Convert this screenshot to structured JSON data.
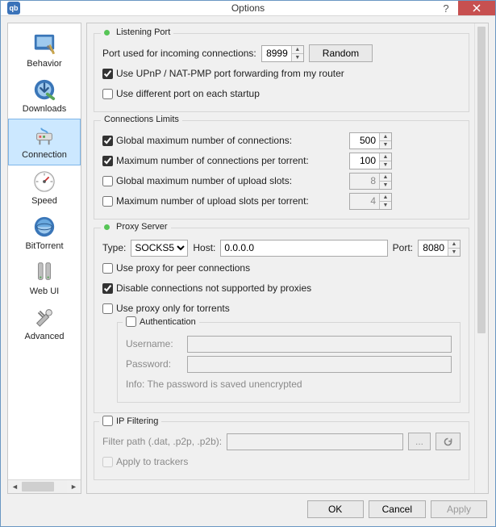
{
  "window": {
    "title": "Options"
  },
  "sidebar": {
    "items": [
      {
        "label": "Behavior"
      },
      {
        "label": "Downloads"
      },
      {
        "label": "Connection"
      },
      {
        "label": "Speed"
      },
      {
        "label": "BitTorrent"
      },
      {
        "label": "Web UI"
      },
      {
        "label": "Advanced"
      }
    ],
    "selected_index": 2
  },
  "listening_port": {
    "legend": "Listening Port",
    "port_label": "Port used for incoming connections:",
    "port_value": "8999",
    "random_btn": "Random",
    "upnp_checked": true,
    "upnp_label": "Use UPnP / NAT-PMP port forwarding from my router",
    "diffstart_checked": false,
    "diffstart_label": "Use different port on each startup"
  },
  "conn_limits": {
    "legend": "Connections Limits",
    "rows": [
      {
        "checked": true,
        "label": "Global maximum number of connections:",
        "value": "500",
        "enabled": true
      },
      {
        "checked": true,
        "label": "Maximum number of connections per torrent:",
        "value": "100",
        "enabled": true
      },
      {
        "checked": false,
        "label": "Global maximum number of upload slots:",
        "value": "8",
        "enabled": false
      },
      {
        "checked": false,
        "label": "Maximum number of upload slots per torrent:",
        "value": "4",
        "enabled": false
      }
    ]
  },
  "proxy": {
    "legend": "Proxy Server",
    "type_label": "Type:",
    "type_value": "SOCKS5",
    "host_label": "Host:",
    "host_value": "0.0.0.0",
    "port_label": "Port:",
    "port_value": "8080",
    "use_peer_checked": false,
    "use_peer_label": "Use proxy for peer connections",
    "disable_unsupported_checked": true,
    "disable_unsupported_label": "Disable connections not supported by proxies",
    "only_torrents_checked": false,
    "only_torrents_label": "Use proxy only for torrents",
    "auth": {
      "checked": false,
      "legend": "Authentication",
      "username_label": "Username:",
      "username_value": "",
      "password_label": "Password:",
      "password_value": "",
      "info": "Info: The password is saved unencrypted"
    }
  },
  "ipfilter": {
    "checked": false,
    "legend": "IP Filtering",
    "path_label": "Filter path (.dat, .p2p, .p2b):",
    "path_value": "",
    "browse_btn": "...",
    "apply_trackers_checked": false,
    "apply_trackers_label": "Apply to trackers"
  },
  "buttons": {
    "ok": "OK",
    "cancel": "Cancel",
    "apply": "Apply"
  }
}
